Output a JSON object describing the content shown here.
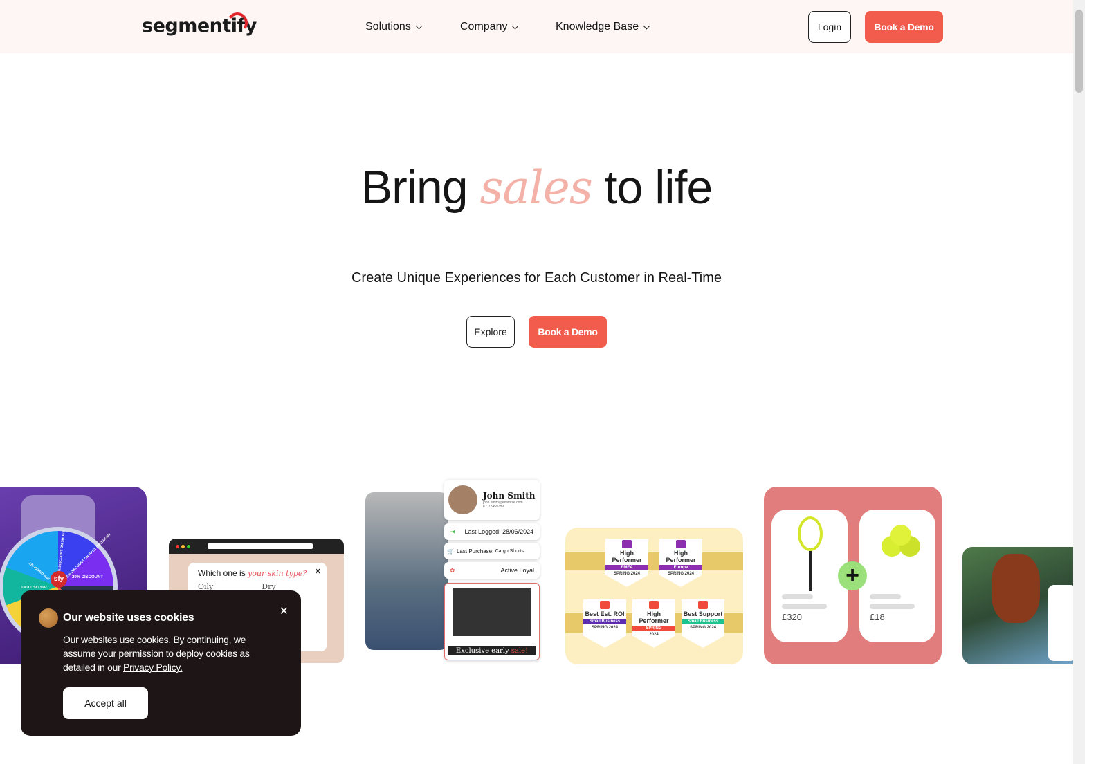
{
  "header": {
    "logo": "segmentify",
    "nav": [
      {
        "label": "Solutions"
      },
      {
        "label": "Company"
      },
      {
        "label": "Knowledge Base"
      }
    ],
    "login_label": "Login",
    "demo_label": "Book a Demo"
  },
  "hero": {
    "title_before": "Bring",
    "title_accent": "sales",
    "title_after": "to life",
    "subtitle": "Create Unique Experiences for Each Customer in Real-Time",
    "explore_label": "Explore",
    "demo_label": "Book a Demo"
  },
  "showcase": {
    "wheel": {
      "segments": [
        "20% DISCOUNT ON SHOES",
        "20% DISCOUNT ON BABY CATEGORY",
        "20% DISCOUNT",
        "20% DISCOUNT",
        "20% DISCOUNT"
      ],
      "center": "sfy"
    },
    "quiz": {
      "question": "Which one is",
      "question_accent": "your skin type?",
      "options": [
        "Oily",
        "Dry"
      ]
    },
    "profile": {
      "name": "John Smith",
      "email": "john.smith@example.com",
      "id": "ID: 12459789",
      "last_logged": "Last Logged: 28/06/2024",
      "last_purchase_label": "Last Purchase:",
      "last_purchase": "Cargo Shorts",
      "status": "Active Loyal",
      "promo_text": "Exclusive early",
      "promo_accent": "sale!"
    },
    "badges": [
      {
        "title": "High Performer",
        "ribbon": "EMEA",
        "season": "SPRING 2024",
        "color": "#8b2fb0"
      },
      {
        "title": "High Performer",
        "ribbon": "Europe",
        "season": "SPRING 2024",
        "color": "#8b2fb0"
      },
      {
        "title": "Best Est. ROI",
        "ribbon": "Small Business",
        "season": "SPRING 2024",
        "color": "#5b2bb0"
      },
      {
        "title": "High Performer",
        "ribbon": "SPRING",
        "season": "2024",
        "color": "#f04a3a"
      },
      {
        "title": "Best Support",
        "ribbon": "Small Business",
        "season": "SPRING 2024",
        "color": "#1fc18e"
      }
    ],
    "bundle": {
      "items": [
        {
          "price": "£320"
        },
        {
          "price": "£18"
        }
      ],
      "plus": "+"
    }
  },
  "cookie": {
    "title": "Our website uses cookies",
    "body": "Our websites use cookies. By continuing, we assume your permission to deploy cookies as detailed in our",
    "link": "Privacy Policy.",
    "accept_label": "Accept all"
  },
  "colors": {
    "accent": "#f25c4c",
    "nav_bg": "#fdf6f5",
    "cookie_bg": "#1e1516",
    "title_accent": "#f4b1a8"
  }
}
